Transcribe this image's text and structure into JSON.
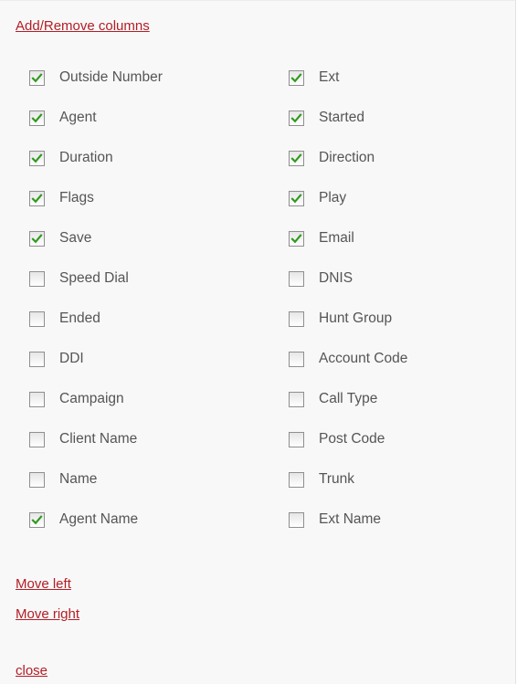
{
  "panel": {
    "title": "Add/Remove columns",
    "move_left": "Move left",
    "move_right": "Move right",
    "close": "close"
  },
  "colors": {
    "link": "#b21e26",
    "check": "#2f9a1c",
    "label": "#555555",
    "background": "#f8f8f8"
  },
  "columns": {
    "left": [
      {
        "label": "Outside Number",
        "checked": true
      },
      {
        "label": "Agent",
        "checked": true
      },
      {
        "label": "Duration",
        "checked": true
      },
      {
        "label": "Flags",
        "checked": true
      },
      {
        "label": "Save",
        "checked": true
      },
      {
        "label": "Speed Dial",
        "checked": false
      },
      {
        "label": "Ended",
        "checked": false
      },
      {
        "label": "DDI",
        "checked": false
      },
      {
        "label": "Campaign",
        "checked": false
      },
      {
        "label": "Client Name",
        "checked": false
      },
      {
        "label": "Name",
        "checked": false
      },
      {
        "label": "Agent Name",
        "checked": true
      }
    ],
    "right": [
      {
        "label": "Ext",
        "checked": true
      },
      {
        "label": "Started",
        "checked": true
      },
      {
        "label": "Direction",
        "checked": true
      },
      {
        "label": "Play",
        "checked": true
      },
      {
        "label": "Email",
        "checked": true
      },
      {
        "label": "DNIS",
        "checked": false
      },
      {
        "label": "Hunt Group",
        "checked": false
      },
      {
        "label": "Account Code",
        "checked": false
      },
      {
        "label": "Call Type",
        "checked": false
      },
      {
        "label": "Post Code",
        "checked": false
      },
      {
        "label": "Trunk",
        "checked": false
      },
      {
        "label": "Ext Name",
        "checked": false
      }
    ]
  }
}
